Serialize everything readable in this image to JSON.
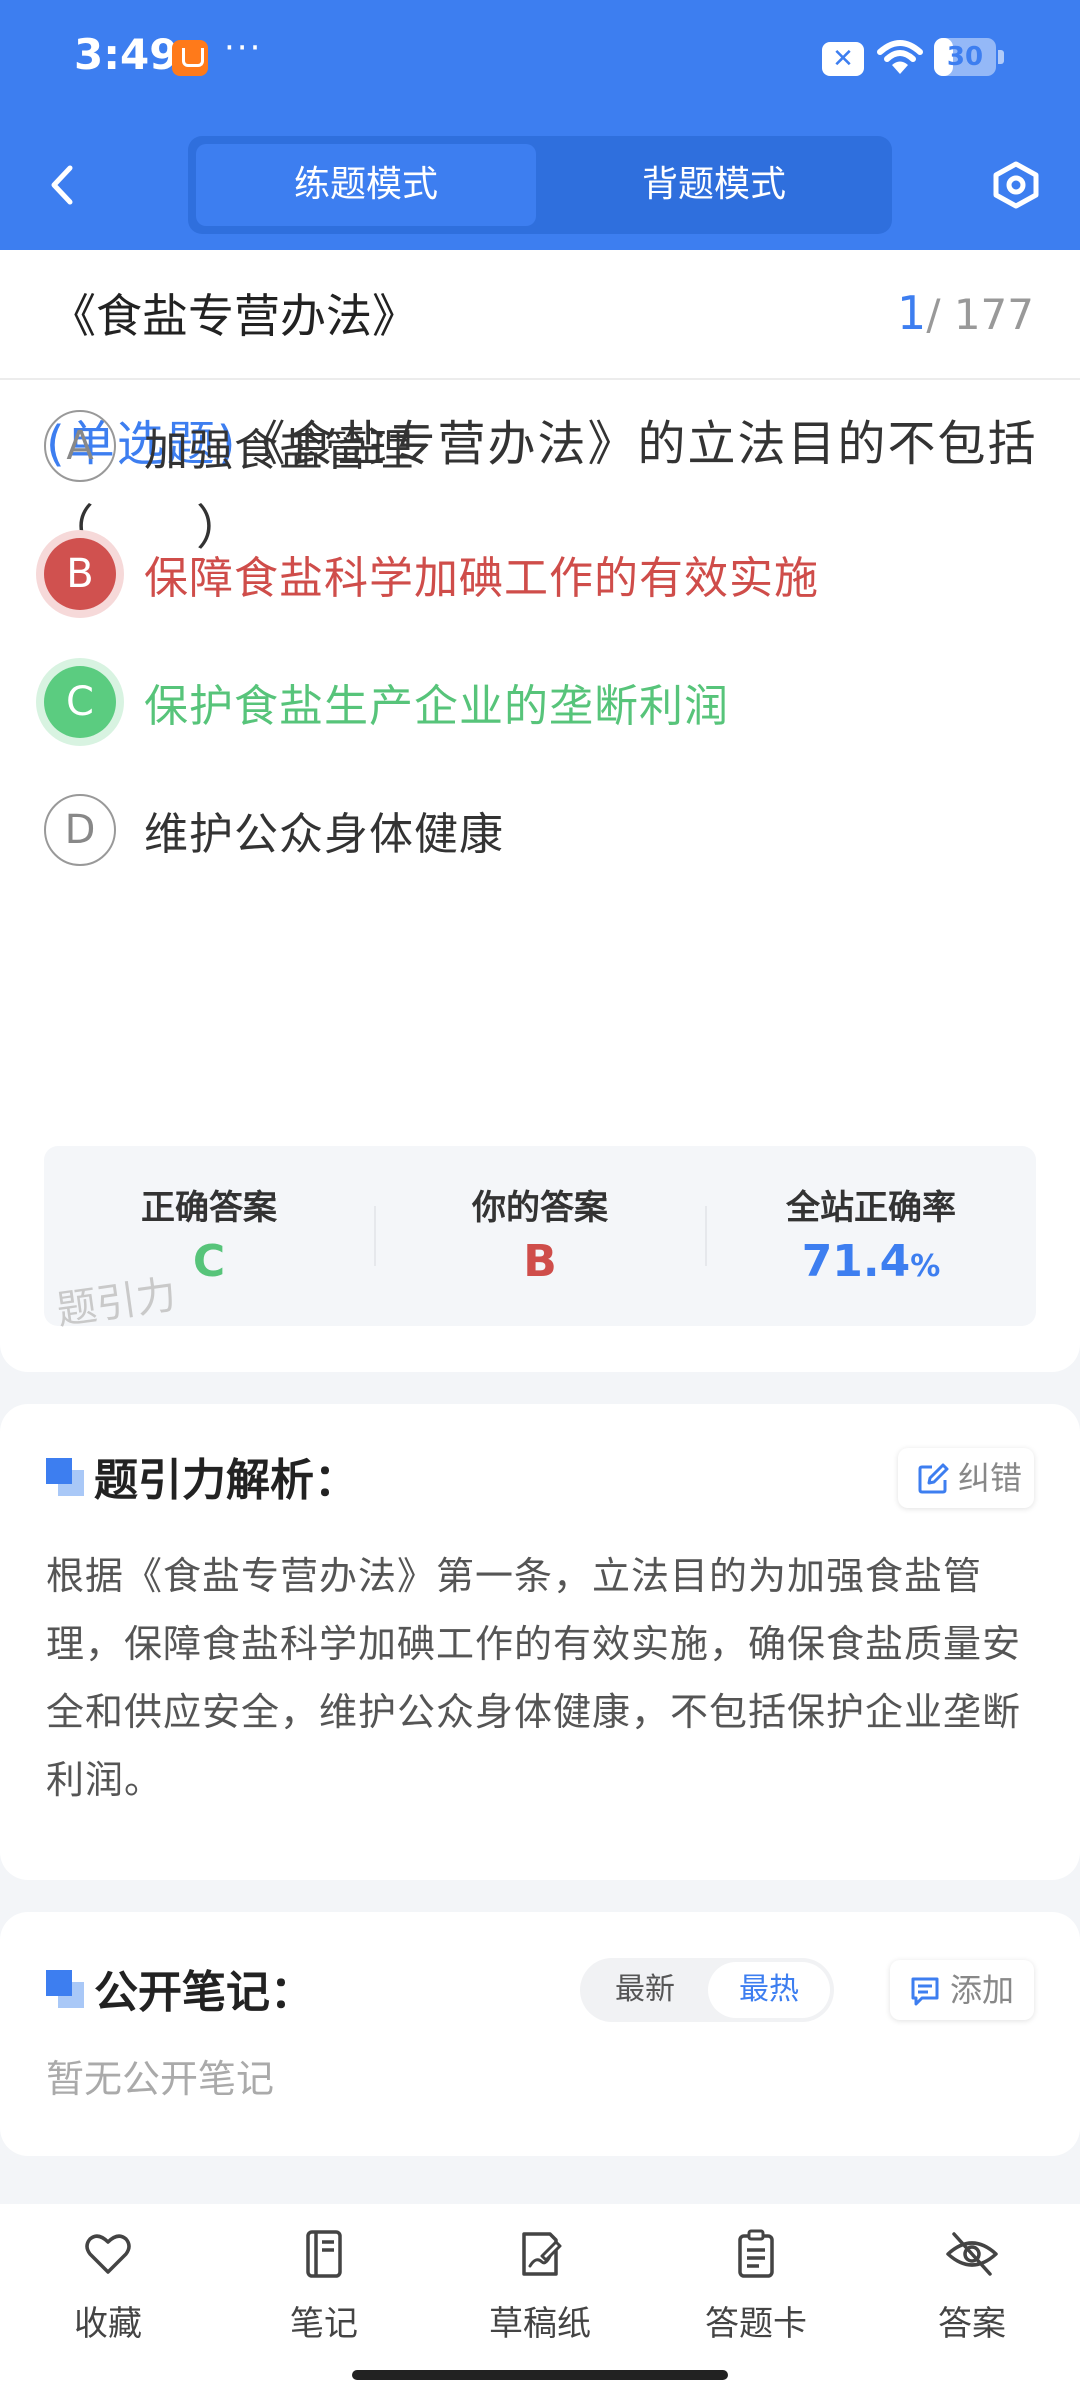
{
  "status_bar": {
    "time": "3:49",
    "more": "···",
    "battery": "30",
    "battery_level": 0.3
  },
  "header": {
    "tabs": [
      {
        "label": "练题模式",
        "active": true
      },
      {
        "label": "背题模式",
        "active": false
      }
    ]
  },
  "question": {
    "chapter": "《食盐专营办法》",
    "current": "1",
    "total": "/ 177",
    "type_label": "(单选题)",
    "stem": "《食盐专营办法》的立法目的不包括（　　）",
    "options": [
      {
        "letter": "A",
        "text": "加强食盐管理",
        "state": "normal"
      },
      {
        "letter": "B",
        "text": "保障食盐科学加碘工作的有效实施",
        "state": "wrong"
      },
      {
        "letter": "C",
        "text": "保护食盐生产企业的垄断利润",
        "state": "correct"
      },
      {
        "letter": "D",
        "text": "维护公众身体健康",
        "state": "normal"
      }
    ]
  },
  "answer_summary": {
    "correct_label": "正确答案",
    "correct_value": "C",
    "yours_label": "你的答案",
    "yours_value": "B",
    "rate_label": "全站正确率",
    "rate_value": "71.4",
    "rate_unit": "%",
    "watermark": "题引力"
  },
  "analysis": {
    "title": "题引力解析：",
    "report_label": "纠错",
    "body": "根据《食盐专营办法》第一条，立法目的为加强食盐管理，保障食盐科学加碘工作的有效实施，确保食盐质量安全和供应安全，维护公众身体健康，不包括保护企业垄断利润。"
  },
  "notes": {
    "title": "公开笔记：",
    "sort_options": [
      "最新",
      "最热"
    ],
    "active_sort": "最热",
    "add_label": "添加",
    "empty_text": "暂无公开笔记"
  },
  "bottom_bar": {
    "items": [
      {
        "label": "收藏",
        "icon": "heart-icon"
      },
      {
        "label": "笔记",
        "icon": "notebook-icon"
      },
      {
        "label": "草稿纸",
        "icon": "draft-paper-icon"
      },
      {
        "label": "答题卡",
        "icon": "answer-sheet-icon"
      },
      {
        "label": "答案",
        "icon": "eye-off-icon"
      }
    ]
  },
  "colors": {
    "primary": "#3d7ef0",
    "wrong": "#cf4d4a",
    "correct": "#57c47a"
  }
}
